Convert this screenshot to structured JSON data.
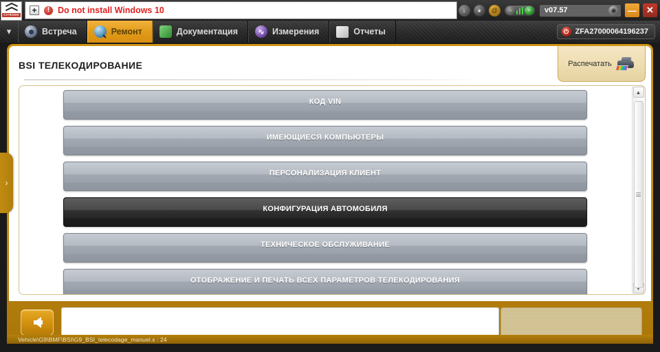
{
  "notification": {
    "expand_icon": "plus-box-icon",
    "warning_icon": "warning-circle-icon",
    "message": "Do not install Windows 10",
    "message_color": "#e02020",
    "brand_logo": "citroen-logo",
    "brand_word": "CITROEN"
  },
  "toolbar": {
    "icons": [
      {
        "name": "download-icon",
        "glyph": "↓"
      },
      {
        "name": "droplet-icon",
        "glyph": "◕"
      },
      {
        "name": "at-sign-icon",
        "glyph": "@"
      }
    ],
    "connection": {
      "minus_icon": "minus-icon",
      "minus_glyph": "−",
      "signal_icon": "signal-bars-icon",
      "plus_icon": "plus-icon",
      "plus_glyph": "+"
    },
    "version": "v07.57",
    "version_knob_icon": "dial-knob-icon",
    "minimize_label": "—",
    "close_label": "✕"
  },
  "tabbar": {
    "chevron_glyph": "▾",
    "tabs": [
      {
        "label": "Встреча",
        "icon": "meeting-icon",
        "active": false
      },
      {
        "label": "Ремонт",
        "icon": "magnifier-icon",
        "active": true
      },
      {
        "label": "Документация",
        "icon": "book-icon",
        "active": false
      },
      {
        "label": "Измерения",
        "icon": "waveform-icon",
        "active": false
      },
      {
        "label": "Отчеты",
        "icon": "report-icon",
        "active": false
      }
    ],
    "vin": "ZFA27000064196237",
    "vin_icon": "power-icon",
    "vin_icon_glyph": "⏻"
  },
  "page": {
    "title": "BSI  ТЕЛЕКОДИРОВАНИЕ",
    "print_label": "Распечатать",
    "print_icon": "printer-icon",
    "accent_color": "#c98f10",
    "selected_color": "#262626"
  },
  "menu": {
    "items": [
      {
        "label": "КОД VIN",
        "selected": false
      },
      {
        "label": "ИМЕЮЩИЕСЯ КОМПЬЮТЕРЫ",
        "selected": false
      },
      {
        "label": "ПЕРСОНАЛИЗАЦИЯ КЛИЕНТ",
        "selected": false
      },
      {
        "label": "КОНФИГУРАЦИЯ АВТОМОБИЛЯ",
        "selected": true
      },
      {
        "label": "ТЕХНИЧЕСКОЕ ОБСЛУЖИВАНИЕ",
        "selected": false
      },
      {
        "label": "ОТОБРАЖЕНИЕ И ПЕЧАТЬ ВСЕХ ПАРАМЕТРОВ ТЕЛЕКОДИРОВАНИЯ",
        "selected": false
      }
    ]
  },
  "scrollbar": {
    "up_glyph": "▲",
    "down_glyph": "▼"
  },
  "footer": {
    "back_icon": "back-arrow-icon",
    "message_value": "",
    "status_path": "Vehicle\\G9\\BMF\\BSI\\G9_BSI_telecodage_manuel.s : 24"
  },
  "drawer": {
    "toggle_glyph": "›"
  }
}
